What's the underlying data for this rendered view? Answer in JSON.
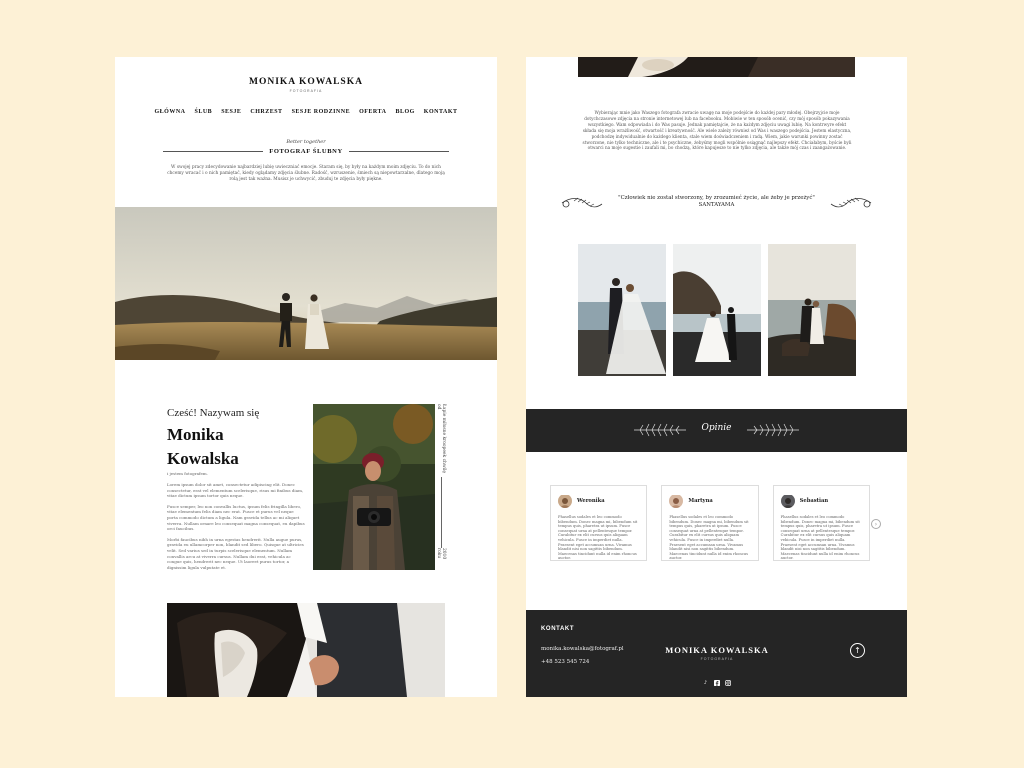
{
  "brand": {
    "name": "MONIKA KOWALSKA",
    "tagline": "FOTOGRAFIA"
  },
  "nav": [
    {
      "label": "GŁÓWNA"
    },
    {
      "label": "ŚLUB"
    },
    {
      "label": "SESJE"
    },
    {
      "label": "CHRZEST"
    },
    {
      "label": "SESJE RODZINNE"
    },
    {
      "label": "OFERTA"
    },
    {
      "label": "BLOG"
    },
    {
      "label": "KONTAKT"
    }
  ],
  "hero_section": {
    "script": "Better together",
    "title": "FOTOGRAF ŚLUBNY",
    "intro": "W swojej pracy zdecydowanie najbardziej lubię uwieczniać emocje. Staram się, by były na każdym moim zdjęciu. To do nich chcemy wracać i o nich pamiętać, kiedy oglądamy zdjęcia ślubne. Radość, wzruszenie, śmiech są niepowtarzalne, dlatego moją rolą jest tak ważna. Musisz je uchwycić, zbuduj te zdjęcia były piękne."
  },
  "about": {
    "greeting": "Cześć! Nazywam się",
    "name_first": "Monika",
    "name_last": "Kowalska",
    "role": "i jestem fotografem.",
    "paragraphs": [
      "Lorem ipsum dolor sit amet, consectetur adipiscing elit. Donec consectetur, erat vel elementum scelerisque, risus mi finibus diam, vitae dictum ipsum tortor quis neque.",
      "Fusce semper, leo non convallis luctus, ipsum felis fringilla libero, vitae elementum felis diam nec erat. Fusce et purus vel neque porta commodo dictum a ligula. Nam gravida tellus ac mi aliquet viverra. Nullam ornare leo consequat magna consequat, eu dapibus orci faucibus.",
      "Morbi faucibus nibh in urna egestas hendrerit. Nulla augue purus, gravida eu ullamcorper non, blandit sed libero. Quisque at ultricies velit. Sed varius sed in turpis scelerisque elementum. Nullam convallis arcu at viverra cursus. Nullam dui erat, vehicula ac congue quis, hendrerit nec neque. Ut laoreet purus tortor, a dignissim ligula vulputate et."
    ],
    "side_caption": "Łapie miłosne kroopeek chwilę od",
    "side_year": "2010 roku"
  },
  "approach": {
    "text": "Wybierając mnie jako Waszego fotografa zwracie uwagę na moje podejście do każdej pary młodej. Obejrzyjcie moje dotychczasowe zdjęcia na stronie internetowej lub na facebooku. Mobiwie w ten sposób ocenić, czy mój sposób pokazywania wszystkiego. Wam odpowiada i do Was pasuje. Jednak pamiętajcie, że na każdym zdjęciu uwagi lubię. Na kontrwyre efekt składa się moja wrażliwość, otwartość i kreatywność. Ale wiele zależy również od Was i waszego podejścia. Jestem elastyczna, podchodzę indywidualnie do każdego klienta, stale wiem doświadczeniem i radą. Wiem, jakie warunki powinny zostać stworzone, nie tylko techniczne, ale i te psychiczne, żebyśmy mogli wspólnie osiągnąć najlepszy efekt. Chciałabym, byście byli otwarci na moje sugestie i zaufali mi, bo chodzą, które kapujesze to nie tylko zdjęcia, ale także mój czas i zaangażowanie."
  },
  "quote": {
    "text": "\"Człowiek nie został stworzony, by zrozumieć życie, ale żeby je przeżyć\"",
    "author": "SANTAYAMA"
  },
  "reviews": {
    "title": "Opinie",
    "items": [
      {
        "name": "Weronika",
        "text": "Phasellus sodales et leo commodo bibendum. Donec magna mi, bibendum sit tempus quis, pharetra ut ipsum. Fusce consequat urna at pellentesque tempor. Curabitur ex elit cursus quis aliquam vehicula. Fusce in imperdiet nulla. Praesent eget accumsan urna. Vivamus blandit nisi non sagittis bibendum. Maecenas tincidunt nulla id enim rhoncus auctor."
      },
      {
        "name": "Martyna",
        "text": "Phasellus sodales et leo commodo bibendum. Donec magna mi, bibendum sit tempus quis, pharetra ut ipsum. Fusce consequat urna at pellentesque tempor. Curabitur ex elit cursus quis aliquam vehicula. Fusce in imperdiet nulla. Praesent eget accumsan urna. Vivamus blandit nisi non sagittis bibendum. Maecenas tincidunt nulla id enim rhoncus auctor."
      },
      {
        "name": "Sebastian",
        "text": "Phasellus sodales et leo commodo bibendum. Donec magna mi, bibendum sit tempus quis, pharetra ut ipsum. Fusce consequat urna at pellentesque tempor. Curabitur ex elit cursus quis aliquam vehicula. Fusce in imperdiet nulla. Praesent eget accumsan urna. Vivamus blandit nisi non sagittis bibendum. Maecenas tincidunt nulla id enim rhoncus auctor."
      }
    ],
    "next_icon": "chevron-right-icon"
  },
  "footer": {
    "label": "KONTAKT",
    "email": "monika.kowalska@fotograf.pl",
    "phone": "+48 523 545 724",
    "social_icons": [
      "tiktok-icon",
      "facebook-icon",
      "instagram-icon"
    ],
    "up_icon": "arrow-up-icon"
  },
  "colors": {
    "background": "#fdf1d6",
    "page": "#ffffff",
    "dark": "#252525"
  }
}
